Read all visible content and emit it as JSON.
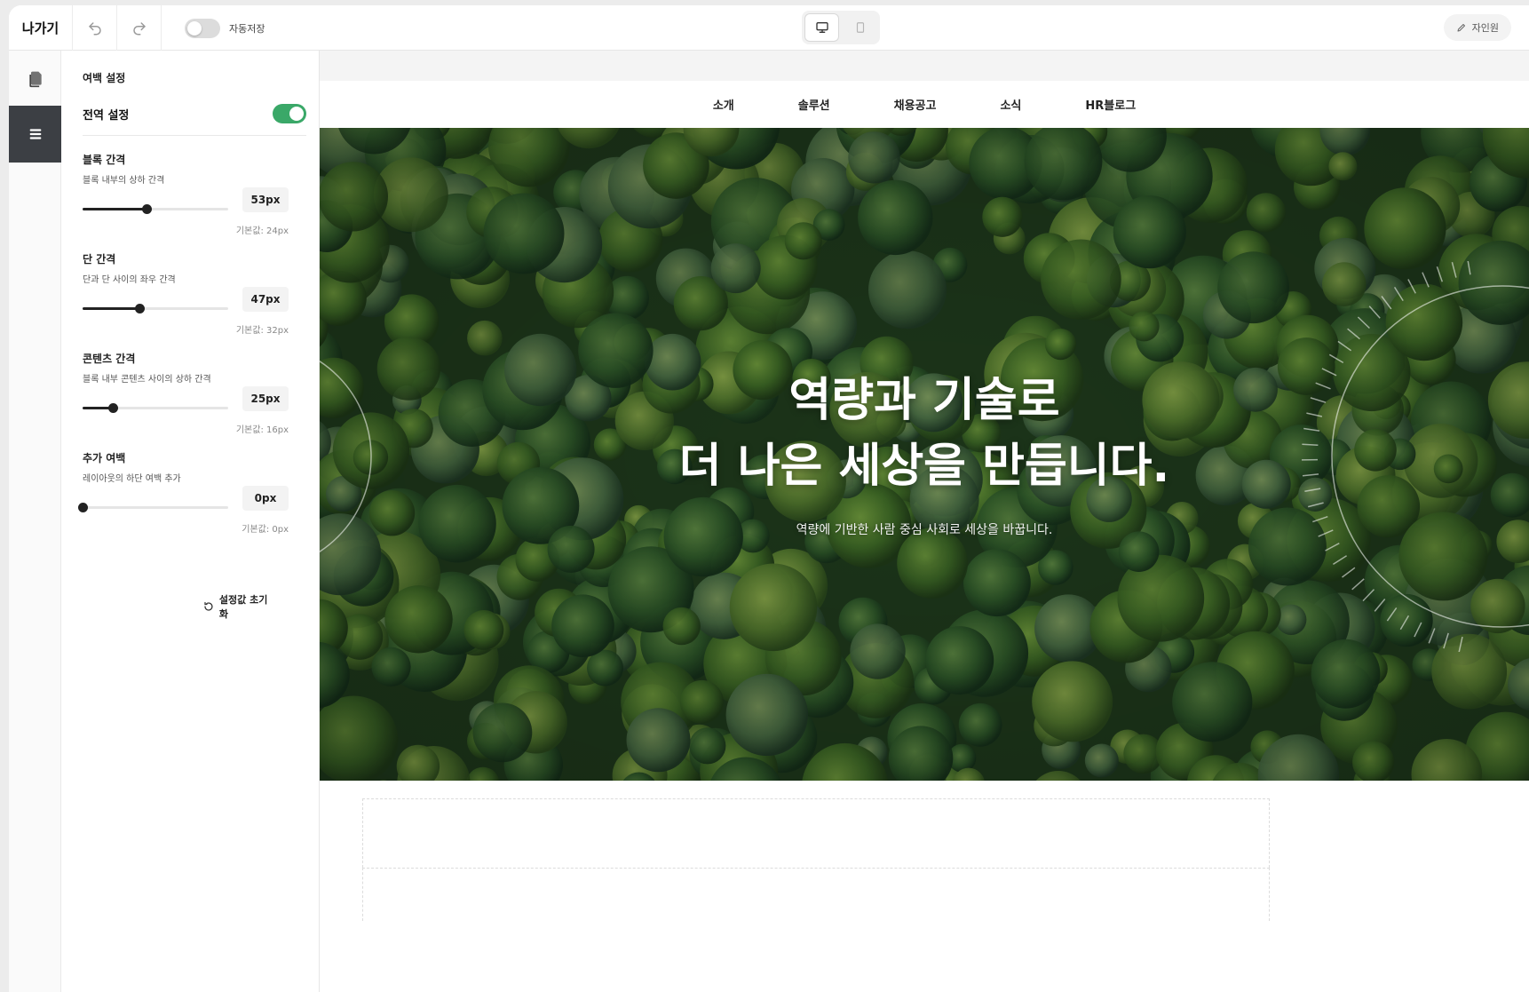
{
  "toolbar": {
    "exit_label": "나가기",
    "autosave_label": "자동저장",
    "autosave_on": false,
    "resume_label": "자인원"
  },
  "panel": {
    "title": "여백 설정",
    "global_label": "전역 설정",
    "global_on": true,
    "settings": [
      {
        "title": "블록 간격",
        "desc": "블록 내부의 상하 간격",
        "value": "53px",
        "fraction": 0.44,
        "default": "기본값: 24px"
      },
      {
        "title": "단 간격",
        "desc": "단과 단 사이의 좌우 간격",
        "value": "47px",
        "fraction": 0.39,
        "default": "기본값: 32px"
      },
      {
        "title": "콘텐츠 간격",
        "desc": "블록 내부 콘텐츠 사이의 상하 간격",
        "value": "25px",
        "fraction": 0.21,
        "default": "기본값: 16px"
      },
      {
        "title": "추가 여백",
        "desc": "레이아웃의 하단 여백 추가",
        "value": "0px",
        "fraction": 0.0,
        "default": "기본값: 0px"
      }
    ],
    "reset_label": "설정값 초기화"
  },
  "site": {
    "nav": [
      "소개",
      "솔루션",
      "채용공고",
      "소식",
      "HR블로그"
    ],
    "hero_line1": "역량과 기술로",
    "hero_line2": "더 나은 세상을 만듭니다.",
    "hero_sub": "역량에 기반한 사람 중심 사회로 세상을 바꿉니다."
  },
  "colors": {
    "toggle_on": "#3aa868",
    "rail_active": "#3c3f44"
  }
}
